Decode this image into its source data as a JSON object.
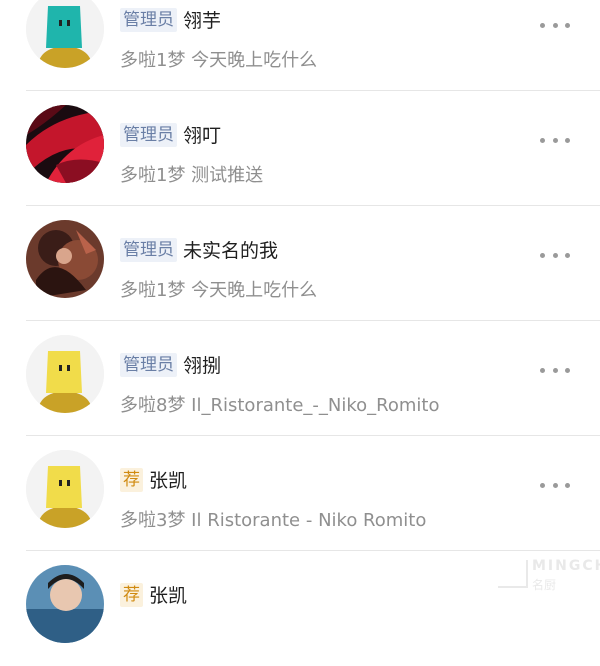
{
  "rows": [
    {
      "badge": "管理员",
      "badge_type": "admin",
      "name": "翎芋",
      "subtitle": "多啦1梦 今天晚上吃什么",
      "avatar": "robot-teal-avatar"
    },
    {
      "badge": "管理员",
      "badge_type": "admin",
      "name": "翎叮",
      "subtitle": "多啦1梦 测试推送",
      "avatar": "red-abstract-avatar"
    },
    {
      "badge": "管理员",
      "badge_type": "admin",
      "name": "未实名的我",
      "subtitle": "多啦1梦 今天晚上吃什么",
      "avatar": "anime-character-avatar"
    },
    {
      "badge": "管理员",
      "badge_type": "admin",
      "name": "翎捌",
      "subtitle": "多啦8梦 Il_Ristorante_-_Niko_Romito",
      "avatar": "robot-yellow-avatar"
    },
    {
      "badge": "荐",
      "badge_type": "rec",
      "name": "张凯",
      "subtitle": "多啦3梦 Il Ristorante - Niko Romito",
      "avatar": "robot-yellow-avatar"
    },
    {
      "badge": "荐",
      "badge_type": "rec",
      "name": "张凯",
      "subtitle": "",
      "avatar": "photo-person-avatar"
    }
  ],
  "watermark": {
    "en": "MINGCHU",
    "cn": "名厨"
  },
  "colors": {
    "admin_badge": "#6a7fa6",
    "recommend_badge": "#d08a10",
    "divider": "#e6e6e6"
  }
}
